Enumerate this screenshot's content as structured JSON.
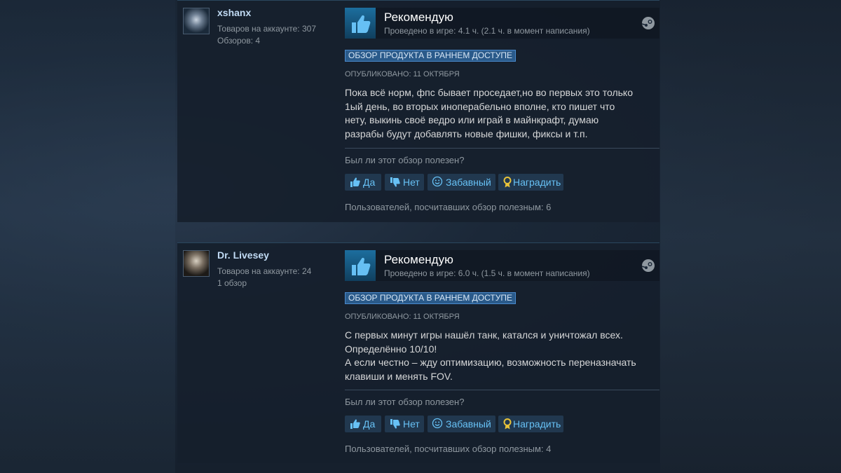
{
  "reviews": [
    {
      "author": {
        "name": "xshanx",
        "products": "Товаров на аккаунте: 307",
        "reviews": "Обзоров: 4"
      },
      "verdict": "Рекомендую",
      "hours": "Проведено в игре: 4.1 ч. (2.1 ч. в момент написания)",
      "tag": "ОБЗОР ПРОДУКТА В РАННЕМ ДОСТУПЕ",
      "posted": "ОПУБЛИКОВАНО: 11 ОКТЯБРЯ",
      "text": [
        "Пока всё норм, фпс бывает проседает,но во первых это только",
        "1ый день, во вторых иноперабельно вполне, кто пишет что",
        "нету, выкинь своё ведро или играй в майнкрафт, думаю",
        "разрабы будут добавлять новые фишки, фиксы и т.п."
      ],
      "helpful_question": "Был ли этот обзор полезен?",
      "buttons": {
        "yes": "Да",
        "no": "Нет",
        "funny": "Забавный",
        "award": "Наградить"
      },
      "found_helpful": "Пользователей, посчитавших обзор полезным: 6"
    },
    {
      "author": {
        "name": "Dr. Livesey",
        "products": "Товаров на аккаунте: 24",
        "reviews": "1 обзор"
      },
      "verdict": "Рекомендую",
      "hours": "Проведено в игре: 6.0 ч. (1.5 ч. в момент написания)",
      "tag": "ОБЗОР ПРОДУКТА В РАННЕМ ДОСТУПЕ",
      "posted": "ОПУБЛИКОВАНО: 11 ОКТЯБРЯ",
      "text": [
        "С первых минут игры нашёл танк, катался и уничтожал всех.",
        "Определённо 10/10!",
        "А если честно – жду оптимизацию, возможность переназначать",
        "клавиши и менять FOV."
      ],
      "helpful_question": "Был ли этот обзор полезен?",
      "buttons": {
        "yes": "Да",
        "no": "Нет",
        "funny": "Забавный",
        "award": "Наградить"
      },
      "found_helpful": "Пользователей, посчитавших обзор полезным: 4"
    }
  ],
  "icons": {
    "thumb_up": "thumbs-up-icon",
    "thumb_down": "thumbs-down-icon",
    "smile": "smile-icon",
    "award": "award-icon",
    "steam": "steam-logo-icon"
  },
  "colors": {
    "background": "#1b2838",
    "link": "#67c1f5",
    "author": "#c1dbf4",
    "muted": "#8f98a0",
    "award_gold": "#e8c33a"
  }
}
